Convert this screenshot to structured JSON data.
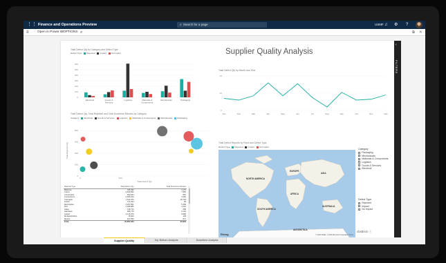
{
  "app": {
    "title": "Finance and Operations Preview",
    "company": "USMF"
  },
  "search": {
    "placeholder": "Search for a page"
  },
  "actions": {
    "open_in_powerbi": "Open in Power BI",
    "options": "OPTIONS"
  },
  "filters_pane": {
    "label": "FILTERS"
  },
  "report": {
    "title": "Supplier Quality Analysis",
    "bar_visual_title": "Total Defect Qty by Category and Defect Type",
    "line_visual_title": "Total Defect Qty by Month and Year",
    "scatter_visual_title": "Total Defect Qty, Total Rejected and Total Downtime Minutes by Category",
    "map_visual_title": "Total Defect Reports by Plant and Defect Type",
    "defect_type_label": "Defect Type",
    "category_label": "Category",
    "defect_types": [
      {
        "name": "Rejected",
        "color": "#1aaea0"
      },
      {
        "name": "Impact",
        "color": "#333333"
      },
      {
        "name": "No Impact",
        "color": "#e14d4f"
      }
    ],
    "scatter_categories": [
      {
        "name": "Electrical",
        "color": "#1aaea0"
      },
      {
        "name": "Goods & Services",
        "color": "#3f3f3f"
      },
      {
        "name": "Logistics",
        "color": "#e14d4f"
      },
      {
        "name": "Materials & Components",
        "color": "#f2c811"
      },
      {
        "name": "Mechanicals",
        "color": "#666666"
      },
      {
        "name": "Packaging",
        "color": "#4ec1e0"
      }
    ]
  },
  "chart_data": [
    {
      "type": "bar",
      "categories": [
        "Electrical",
        "Goods & Services",
        "Logistics",
        "Materials & Components",
        "Mechanicals",
        "Packaging"
      ],
      "series": [
        {
          "name": "Rejected",
          "values": [
            90,
            55,
            120,
            80,
            110,
            330
          ]
        },
        {
          "name": "Impact",
          "values": [
            40,
            95,
            610,
            100,
            210,
            120
          ]
        },
        {
          "name": "No Impact",
          "values": [
            25,
            125,
            150,
            60,
            85,
            280
          ]
        }
      ],
      "yticks": [
        "600",
        "500",
        "400",
        "300",
        "200",
        "100",
        "0"
      ],
      "ylim": [
        0,
        700
      ]
    },
    {
      "type": "line",
      "categories": [
        "Jan",
        "Feb",
        "Mar",
        "Apr",
        "May",
        "Jun",
        "Jul",
        "Aug",
        "Sep",
        "Oct",
        "Nov",
        "Dec"
      ],
      "series": [
        {
          "values": [
            14,
            12,
            17,
            32,
            17,
            31,
            15,
            4,
            21,
            12,
            13,
            18
          ]
        }
      ],
      "yticks": [
        "40",
        "20",
        "0"
      ],
      "ylim": [
        0,
        40
      ]
    },
    {
      "type": "scatter",
      "xlabel": "Total Defect Qty",
      "ylabel": "Total Rejected Qty",
      "yticks": [
        "800",
        "600",
        "400",
        "200",
        "0"
      ],
      "xticks": [
        "0",
        "500"
      ],
      "points": [
        {
          "category": "Electrical",
          "x": 30,
          "y": 120,
          "size": 5,
          "color": "#1aaea0"
        },
        {
          "category": "Goods & Services",
          "x": 170,
          "y": 190,
          "size": 8,
          "color": "#3f3f3f"
        },
        {
          "category": "Logistics",
          "x": 1350,
          "y": 700,
          "size": 12,
          "color": "#e14d4f"
        },
        {
          "category": "Materials & Components",
          "x": 110,
          "y": 430,
          "size": 6,
          "color": "#f2c811"
        },
        {
          "category": "Mechanicals",
          "x": 1020,
          "y": 790,
          "size": 12,
          "color": "#666666"
        },
        {
          "category": "Packaging",
          "x": 1450,
          "y": 570,
          "size": 14,
          "color": "#4ec1e0"
        },
        {
          "category": "Logistics",
          "x": 35,
          "y": 650,
          "size": 4,
          "color": "#e14d4f"
        },
        {
          "category": "Materials & Components",
          "x": 1380,
          "y": 440,
          "size": 4,
          "color": "#f2c811"
        }
      ],
      "xlim": [
        0,
        1600
      ],
      "ylim": [
        0,
        900
      ]
    },
    {
      "type": "table",
      "columns": [
        "Material Type",
        "Total Defect Qty",
        "Total Downtime Minutes"
      ],
      "rows": [
        [
          "Batteries",
          "795,462",
          "2,170"
        ],
        [
          "Carton",
          "3,843,593",
          "7,582"
        ],
        [
          "Composites",
          "463,044",
          "887"
        ],
        [
          "Connections",
          "2,926,012",
          "4,381"
        ],
        [
          "Corrugate",
          "1,511,973",
          "28,729"
        ],
        [
          "Drives",
          "114,464",
          "83"
        ],
        [
          "Electrolytes",
          "1,257,591",
          "5,459"
        ],
        [
          "Film",
          "2,258,983",
          "2,291"
        ],
        [
          "Glass",
          "749,713",
          "658"
        ],
        [
          "Hardware",
          "396,779",
          "2,194"
        ],
        [
          "Labels",
          "4,115,079",
          "5,886"
        ],
        [
          "Molded Rubber",
          "15,620",
          "136"
        ],
        [
          "Motors",
          "617,556",
          "871"
        ]
      ],
      "total": [
        "Total",
        "25,867,953",
        "60,822"
      ]
    }
  ],
  "map": {
    "labels": [
      "NORTH AMERICA",
      "SOUTH AMERICA",
      "EUROPE",
      "ASIA",
      "AFRICA",
      "AUSTRALIA",
      "ANTARCTICA"
    ],
    "provider": "bing",
    "copyright": "© 2018 HERE, © 2018 Microsoft Corporation Terms"
  },
  "category_slicer": {
    "title": "Category",
    "items": [
      "Packaging",
      "Mechanicals",
      "Materials & Components",
      "Logistics",
      "Goods & Services",
      "Electrical"
    ]
  },
  "defect_type_slicer": {
    "title": "Defect Type",
    "items": [
      "Rejected",
      "Impact",
      "No Impact"
    ]
  },
  "brand_text": "obsBrick ⓘ",
  "page_tabs": [
    "Supplier Quality",
    "Top Bottom Analysis",
    "Downtime Analysis"
  ],
  "active_tab": "Supplier Quality"
}
